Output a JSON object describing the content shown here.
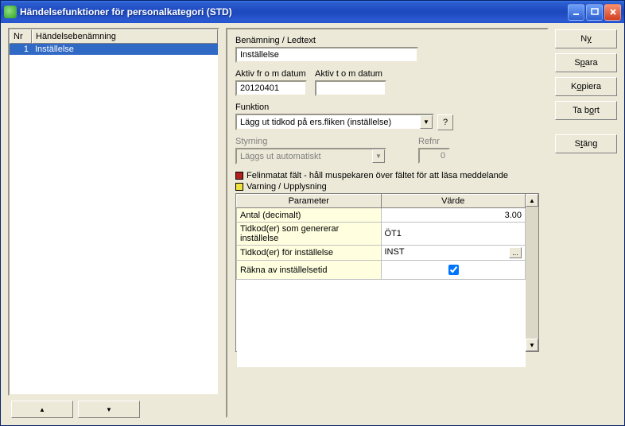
{
  "window": {
    "title": "Händelsefunktioner för personalkategori (STD)"
  },
  "list": {
    "col_nr": "Nr",
    "col_name": "Händelsebenämning",
    "rows": [
      {
        "nr": "1",
        "name": "Inställelse"
      }
    ]
  },
  "arrows": {
    "up": "▲",
    "down": "▼"
  },
  "form": {
    "benamning_label": "Benämning / Ledtext",
    "benamning_value": "Inställelse",
    "aktiv_fr_label": "Aktiv fr o m datum",
    "aktiv_fr_value": "20120401",
    "aktiv_to_label": "Aktiv t o m datum",
    "aktiv_to_value": "",
    "funktion_label": "Funktion",
    "funktion_value": "Lägg ut tidkod på ers.fliken (inställelse)",
    "help_symbol": "?",
    "styrning_label": "Styrning",
    "styrning_value": "Läggs ut automatiskt",
    "refnr_label": "Refnr",
    "refnr_value": "0"
  },
  "legend": {
    "red": "Felinmatat fält - håll muspekaren över fältet för att läsa meddelande",
    "yellow": "Varning / Upplysning"
  },
  "table": {
    "col_param": "Parameter",
    "col_value": "Värde",
    "rows": {
      "r0": {
        "p": "Antal (decimalt)",
        "v": "3.00"
      },
      "r1": {
        "p": "Tidkod(er) som genererar inställelse",
        "v": "ÖT1"
      },
      "r2": {
        "p": "Tidkod(er) för inställelse",
        "v": "INST"
      },
      "r3": {
        "p": "Räkna av inställelsetid",
        "v": "checked"
      }
    },
    "ellipsis": "..."
  },
  "buttons": {
    "ny": "N_y",
    "spara": "S_para",
    "kopiera": "K_opiera",
    "tabort": "Ta b_ort",
    "stang": "S_täng"
  },
  "scroll": {
    "up": "▲",
    "down": "▼"
  }
}
